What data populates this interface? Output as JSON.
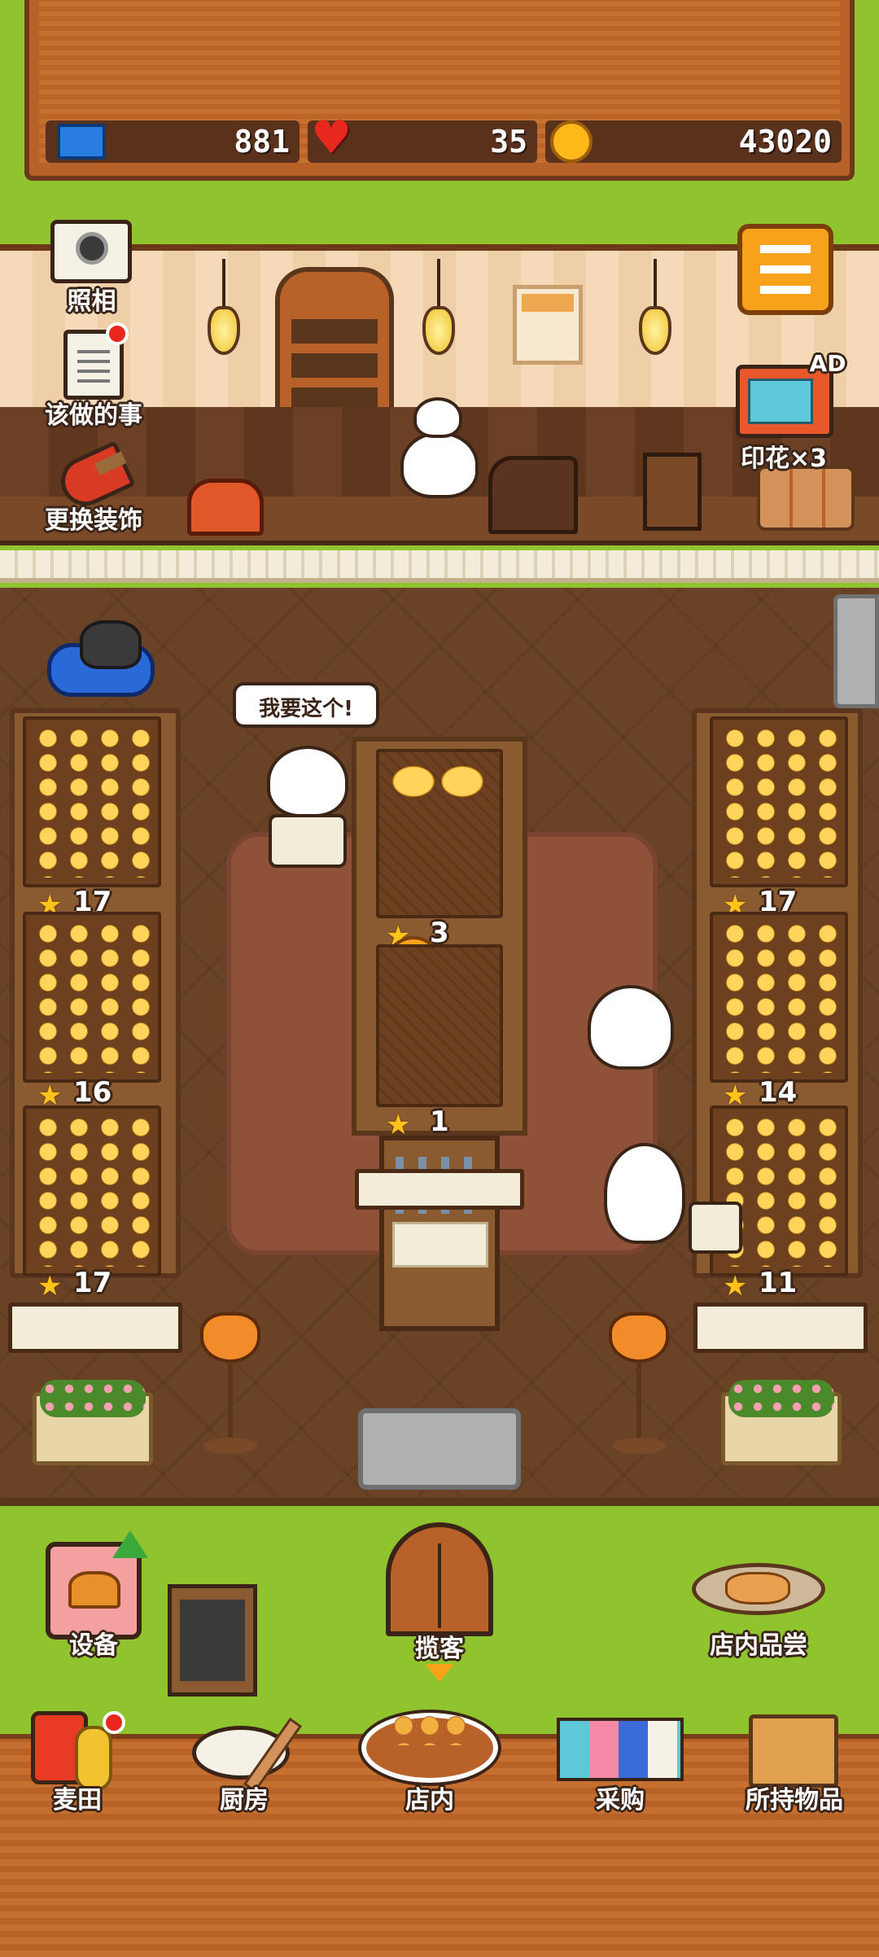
{
  "stats": {
    "tickets": "881",
    "hearts": "35",
    "coins": "43020"
  },
  "left_menu": {
    "camera": "照相",
    "todo": "该做的事",
    "decor": "更换装饰"
  },
  "right_menu": {
    "tv_stamps": "印花×3",
    "tv_badge": "AD"
  },
  "speech_bubble": "我要这个!",
  "shelves": {
    "left": [
      "17",
      "16",
      "17"
    ],
    "right": [
      "17",
      "14",
      "11"
    ],
    "center": [
      "3",
      "1"
    ]
  },
  "bottom_upper": {
    "equipment": "设备",
    "invite": "揽客",
    "tasting": "店内品尝"
  },
  "bottom_nav": {
    "wheat_field": "麦田",
    "kitchen": "厨房",
    "store": "店内",
    "purchase": "采购",
    "inventory": "所持物品"
  },
  "colors": {
    "grass": "#8fc42f",
    "wood": "#b8622a",
    "star": "#ffc31c",
    "menu_button": "#f7a21a",
    "heart": "#e8281e",
    "ticket": "#2a7de0"
  }
}
